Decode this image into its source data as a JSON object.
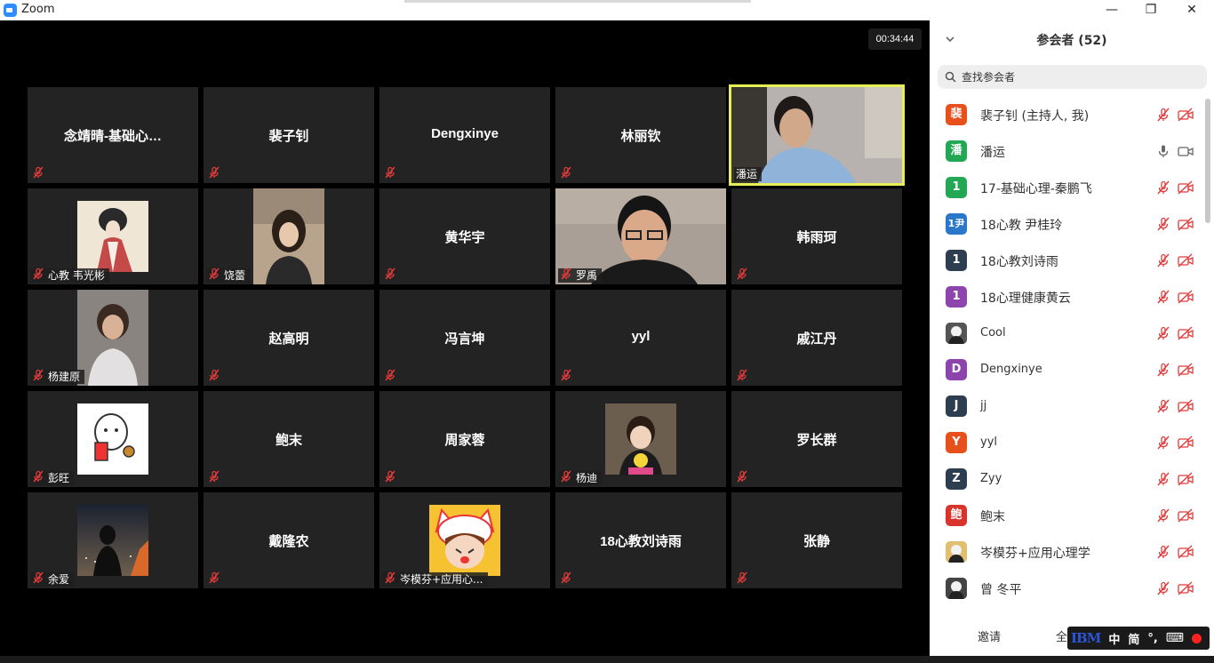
{
  "window": {
    "title": "Zoom",
    "minimize": "—",
    "restore": "❐",
    "close": "✕"
  },
  "meeting": {
    "timer": "00:34:44"
  },
  "tiles": [
    {
      "name": "念靖晴-基础心…",
      "label": ""
    },
    {
      "name": "裴子钊",
      "label": ""
    },
    {
      "name": "Dengxinye",
      "label": ""
    },
    {
      "name": "林丽钦",
      "label": ""
    },
    {
      "name": "",
      "label": "潘运",
      "video": true,
      "speaking": true
    },
    {
      "name": "",
      "label": "心教 韦光彬",
      "avatar": "ink-painting"
    },
    {
      "name": "",
      "label": "饶蕾",
      "avatar": "woman-photo"
    },
    {
      "name": "黄华宇",
      "label": ""
    },
    {
      "name": "",
      "label": "罗禹",
      "video": true
    },
    {
      "name": "韩雨珂",
      "label": ""
    },
    {
      "name": "",
      "label": "杨建原",
      "avatar": "older-woman-photo"
    },
    {
      "name": "赵高明",
      "label": ""
    },
    {
      "name": "冯言坤",
      "label": ""
    },
    {
      "name": "yyl",
      "label": ""
    },
    {
      "name": "戚江丹",
      "label": ""
    },
    {
      "name": "",
      "label": "彭旺",
      "avatar": "cartoon-drink"
    },
    {
      "name": "鲍末",
      "label": ""
    },
    {
      "name": "周家蓉",
      "label": ""
    },
    {
      "name": "",
      "label": "杨迪",
      "avatar": "baby-photo"
    },
    {
      "name": "罗长群",
      "label": ""
    },
    {
      "name": "",
      "label": "余爱",
      "avatar": "night-photo"
    },
    {
      "name": "戴隆农",
      "label": ""
    },
    {
      "name": "",
      "label": "岑模芬+应用心...",
      "avatar": "cartoon-girl"
    },
    {
      "name": "18心教刘诗雨",
      "label": ""
    },
    {
      "name": "张静",
      "label": ""
    }
  ],
  "sidebar": {
    "title": "参会者",
    "count": "(52)",
    "search_placeholder": "查找参会者",
    "participants": [
      {
        "avatar": "裴",
        "color": "#e8501b",
        "name": "裴子钊 (主持人, 我)",
        "mic": "muted",
        "cam": "off"
      },
      {
        "avatar": "潘",
        "color": "#22a852",
        "name": "潘运",
        "mic": "on",
        "cam": "on"
      },
      {
        "avatar": "1",
        "color": "#22a852",
        "name": "17-基础心理-秦鹏飞",
        "mic": "muted",
        "cam": "off"
      },
      {
        "avatar": "1尹",
        "color": "#2b77c9",
        "name": "18心教 尹桂玲",
        "mic": "muted",
        "cam": "off"
      },
      {
        "avatar": "1",
        "color": "#2c3e50",
        "name": "18心教刘诗雨",
        "mic": "muted",
        "cam": "off"
      },
      {
        "avatar": "1",
        "color": "#8e44ad",
        "name": "18心理健康黄云",
        "mic": "muted",
        "cam": "off"
      },
      {
        "avatar": "",
        "color": "#555555",
        "name": "Cool",
        "mic": "muted",
        "cam": "off",
        "photo": true
      },
      {
        "avatar": "D",
        "color": "#8e44ad",
        "name": "Dengxinye",
        "mic": "muted",
        "cam": "off"
      },
      {
        "avatar": "J",
        "color": "#2c3e50",
        "name": "jj",
        "mic": "muted",
        "cam": "off"
      },
      {
        "avatar": "Y",
        "color": "#e8501b",
        "name": "yyl",
        "mic": "muted",
        "cam": "off"
      },
      {
        "avatar": "Z",
        "color": "#2c3e50",
        "name": "Zyy",
        "mic": "muted",
        "cam": "off"
      },
      {
        "avatar": "鲍",
        "color": "#d9342b",
        "name": "鲍末",
        "mic": "muted",
        "cam": "off"
      },
      {
        "avatar": "",
        "color": "#e0c070",
        "name": "岑模芬+应用心理学",
        "mic": "muted",
        "cam": "off",
        "photo": true
      },
      {
        "avatar": "",
        "color": "#444444",
        "name": "曾 冬平",
        "mic": "muted",
        "cam": "off",
        "photo": true
      }
    ],
    "invite_label": "邀请",
    "mute_all_label": "全体静音"
  },
  "ime": {
    "brand": "IBM",
    "lang": "中",
    "mode": "简",
    "punct": "°,"
  }
}
